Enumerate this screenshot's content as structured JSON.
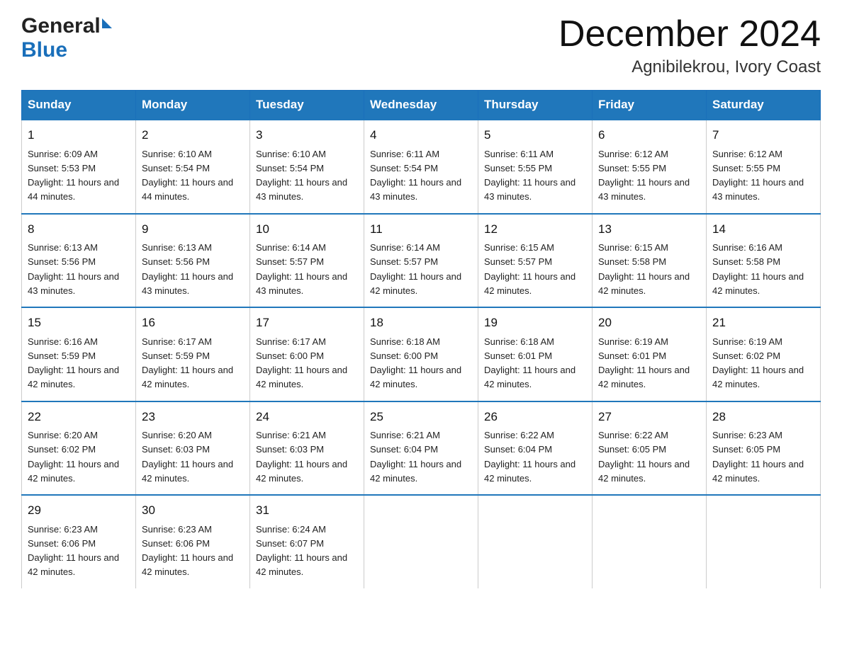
{
  "logo": {
    "general": "General",
    "blue": "Blue"
  },
  "title": "December 2024",
  "location": "Agnibilekrou, Ivory Coast",
  "days_of_week": [
    "Sunday",
    "Monday",
    "Tuesday",
    "Wednesday",
    "Thursday",
    "Friday",
    "Saturday"
  ],
  "weeks": [
    [
      {
        "day": "1",
        "sunrise": "6:09 AM",
        "sunset": "5:53 PM",
        "daylight": "11 hours and 44 minutes."
      },
      {
        "day": "2",
        "sunrise": "6:10 AM",
        "sunset": "5:54 PM",
        "daylight": "11 hours and 44 minutes."
      },
      {
        "day": "3",
        "sunrise": "6:10 AM",
        "sunset": "5:54 PM",
        "daylight": "11 hours and 43 minutes."
      },
      {
        "day": "4",
        "sunrise": "6:11 AM",
        "sunset": "5:54 PM",
        "daylight": "11 hours and 43 minutes."
      },
      {
        "day": "5",
        "sunrise": "6:11 AM",
        "sunset": "5:55 PM",
        "daylight": "11 hours and 43 minutes."
      },
      {
        "day": "6",
        "sunrise": "6:12 AM",
        "sunset": "5:55 PM",
        "daylight": "11 hours and 43 minutes."
      },
      {
        "day": "7",
        "sunrise": "6:12 AM",
        "sunset": "5:55 PM",
        "daylight": "11 hours and 43 minutes."
      }
    ],
    [
      {
        "day": "8",
        "sunrise": "6:13 AM",
        "sunset": "5:56 PM",
        "daylight": "11 hours and 43 minutes."
      },
      {
        "day": "9",
        "sunrise": "6:13 AM",
        "sunset": "5:56 PM",
        "daylight": "11 hours and 43 minutes."
      },
      {
        "day": "10",
        "sunrise": "6:14 AM",
        "sunset": "5:57 PM",
        "daylight": "11 hours and 43 minutes."
      },
      {
        "day": "11",
        "sunrise": "6:14 AM",
        "sunset": "5:57 PM",
        "daylight": "11 hours and 42 minutes."
      },
      {
        "day": "12",
        "sunrise": "6:15 AM",
        "sunset": "5:57 PM",
        "daylight": "11 hours and 42 minutes."
      },
      {
        "day": "13",
        "sunrise": "6:15 AM",
        "sunset": "5:58 PM",
        "daylight": "11 hours and 42 minutes."
      },
      {
        "day": "14",
        "sunrise": "6:16 AM",
        "sunset": "5:58 PM",
        "daylight": "11 hours and 42 minutes."
      }
    ],
    [
      {
        "day": "15",
        "sunrise": "6:16 AM",
        "sunset": "5:59 PM",
        "daylight": "11 hours and 42 minutes."
      },
      {
        "day": "16",
        "sunrise": "6:17 AM",
        "sunset": "5:59 PM",
        "daylight": "11 hours and 42 minutes."
      },
      {
        "day": "17",
        "sunrise": "6:17 AM",
        "sunset": "6:00 PM",
        "daylight": "11 hours and 42 minutes."
      },
      {
        "day": "18",
        "sunrise": "6:18 AM",
        "sunset": "6:00 PM",
        "daylight": "11 hours and 42 minutes."
      },
      {
        "day": "19",
        "sunrise": "6:18 AM",
        "sunset": "6:01 PM",
        "daylight": "11 hours and 42 minutes."
      },
      {
        "day": "20",
        "sunrise": "6:19 AM",
        "sunset": "6:01 PM",
        "daylight": "11 hours and 42 minutes."
      },
      {
        "day": "21",
        "sunrise": "6:19 AM",
        "sunset": "6:02 PM",
        "daylight": "11 hours and 42 minutes."
      }
    ],
    [
      {
        "day": "22",
        "sunrise": "6:20 AM",
        "sunset": "6:02 PM",
        "daylight": "11 hours and 42 minutes."
      },
      {
        "day": "23",
        "sunrise": "6:20 AM",
        "sunset": "6:03 PM",
        "daylight": "11 hours and 42 minutes."
      },
      {
        "day": "24",
        "sunrise": "6:21 AM",
        "sunset": "6:03 PM",
        "daylight": "11 hours and 42 minutes."
      },
      {
        "day": "25",
        "sunrise": "6:21 AM",
        "sunset": "6:04 PM",
        "daylight": "11 hours and 42 minutes."
      },
      {
        "day": "26",
        "sunrise": "6:22 AM",
        "sunset": "6:04 PM",
        "daylight": "11 hours and 42 minutes."
      },
      {
        "day": "27",
        "sunrise": "6:22 AM",
        "sunset": "6:05 PM",
        "daylight": "11 hours and 42 minutes."
      },
      {
        "day": "28",
        "sunrise": "6:23 AM",
        "sunset": "6:05 PM",
        "daylight": "11 hours and 42 minutes."
      }
    ],
    [
      {
        "day": "29",
        "sunrise": "6:23 AM",
        "sunset": "6:06 PM",
        "daylight": "11 hours and 42 minutes."
      },
      {
        "day": "30",
        "sunrise": "6:23 AM",
        "sunset": "6:06 PM",
        "daylight": "11 hours and 42 minutes."
      },
      {
        "day": "31",
        "sunrise": "6:24 AM",
        "sunset": "6:07 PM",
        "daylight": "11 hours and 42 minutes."
      },
      null,
      null,
      null,
      null
    ]
  ]
}
